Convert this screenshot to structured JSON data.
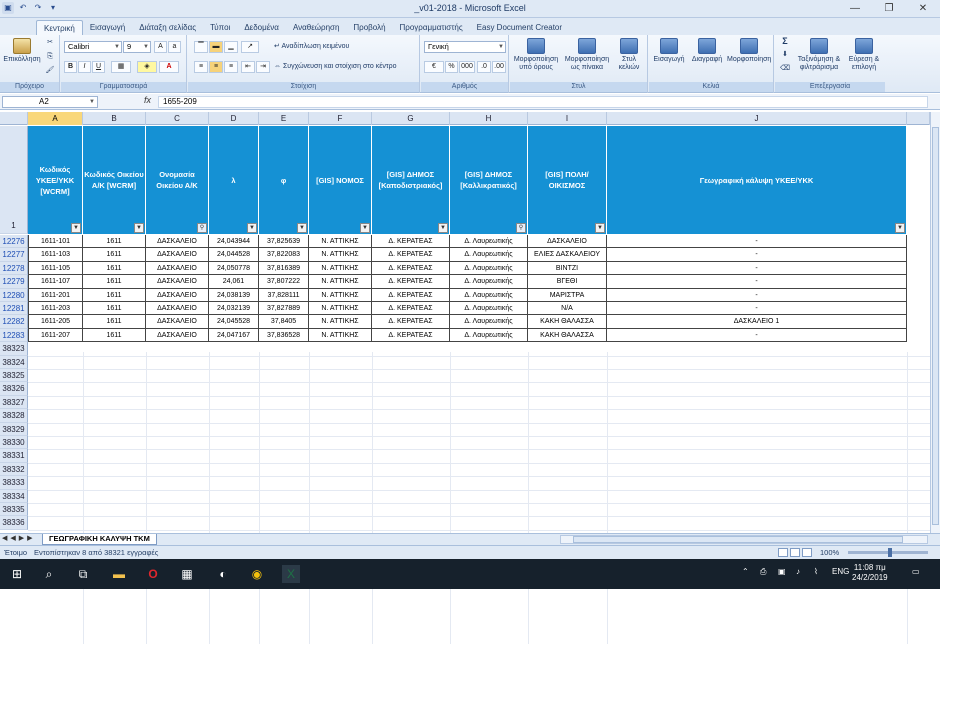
{
  "window": {
    "title": "_v01-2018 - Microsoft Excel",
    "minimize": "—",
    "maximize": "❐",
    "close": "✕"
  },
  "tabs": [
    "Κεντρική",
    "Εισαγωγή",
    "Διάταξη σελίδας",
    "Τύποι",
    "Δεδομένα",
    "Αναθεώρηση",
    "Προβολή",
    "Προγραμματιστής",
    "Easy Document Creator"
  ],
  "ribbon": {
    "clipboard": {
      "paste": "Επικόλληση",
      "label": "Πρόχειρο"
    },
    "font": {
      "name": "Calibri",
      "size": "9",
      "label": "Γραμματοσειρά",
      "bold": "B",
      "italic": "I",
      "underline": "U"
    },
    "alignment": {
      "wrap": "Αναδίπλωση κειμένου",
      "merge": "Συγχώνευση και στοίχιση στο κέντρο",
      "label": "Στοίχιση"
    },
    "number": {
      "format": "Γενική",
      "percent": "%",
      "thousands": "000",
      "label": "Αριθμός"
    },
    "styles": {
      "conditional": "Μορφοποίηση υπό όρους",
      "table": "Μορφοποίηση ως πίνακα",
      "cell": "Στυλ κελιών",
      "label": "Στυλ"
    },
    "cells": {
      "insert": "Εισαγωγή",
      "delete": "Διαγραφή",
      "format": "Μορφοποίηση",
      "label": "Κελιά"
    },
    "editing": {
      "sort": "Ταξινόμηση & φιλτράρισμα",
      "find": "Εύρεση & επιλογή",
      "label": "Επεξεργασία",
      "sum": "Σ"
    }
  },
  "formula_bar": {
    "name_box": "A2",
    "fx": "fx",
    "value": "1655-209"
  },
  "columns": [
    "A",
    "B",
    "C",
    "D",
    "E",
    "F",
    "G",
    "H",
    "I",
    "J"
  ],
  "header_row_number": "1",
  "headers": [
    "Κωδικός ΥΚΕΕ/ΥΚΚ [WCRM]",
    "Κωδικός Οικείου Α/Κ [WCRM]",
    "Ονομασία Οικείου Α/Κ",
    "λ",
    "φ",
    "[GIS] ΝΟΜΟΣ",
    "[GIS] ΔΗΜΟΣ [Καποδιστριακός]",
    "[GIS] ΔΗΜΟΣ [Καλλικρατικός]",
    "[GIS] ΠΟΛΗ/ΟΙΚΙΣΜΟΣ",
    "Γεωγραφική κάλυψη ΥΚΕΕ/ΥΚΚ"
  ],
  "rows": [
    {
      "n": "12276",
      "cells": [
        "1611-101",
        "1611",
        "ΔΑΣΚΑΛΕΙΟ",
        "24,043944",
        "37,825639",
        "Ν. ΑΤΤΙΚΗΣ",
        "Δ. ΚΕΡΑΤΕΑΣ",
        "Δ. Λαυρεωτικής",
        "ΔΑΣΚΑΛΕΙΟ",
        "-"
      ]
    },
    {
      "n": "12277",
      "cells": [
        "1611-103",
        "1611",
        "ΔΑΣΚΑΛΕΙΟ",
        "24,044528",
        "37,822083",
        "Ν. ΑΤΤΙΚΗΣ",
        "Δ. ΚΕΡΑΤΕΑΣ",
        "Δ. Λαυρεωτικής",
        "ΕΛΙΕΣ ΔΑΣΚΑΛΕΙΟΥ",
        "-"
      ]
    },
    {
      "n": "12278",
      "cells": [
        "1611-105",
        "1611",
        "ΔΑΣΚΑΛΕΙΟ",
        "24,050778",
        "37,816389",
        "Ν. ΑΤΤΙΚΗΣ",
        "Δ. ΚΕΡΑΤΕΑΣ",
        "Δ. Λαυρεωτικής",
        "ΒΙΝΤΖΙ",
        "-"
      ]
    },
    {
      "n": "12279",
      "cells": [
        "1611-107",
        "1611",
        "ΔΑΣΚΑΛΕΙΟ",
        "24,061",
        "37,807222",
        "Ν. ΑΤΤΙΚΗΣ",
        "Δ. ΚΕΡΑΤΕΑΣ",
        "Δ. Λαυρεωτικής",
        "ΒΓΕΘΙ",
        "-"
      ]
    },
    {
      "n": "12280",
      "cells": [
        "1611-201",
        "1611",
        "ΔΑΣΚΑΛΕΙΟ",
        "24,038139",
        "37,828111",
        "Ν. ΑΤΤΙΚΗΣ",
        "Δ. ΚΕΡΑΤΕΑΣ",
        "Δ. Λαυρεωτικής",
        "ΜΑΡΙΣΤΡΑ",
        "-"
      ]
    },
    {
      "n": "12281",
      "cells": [
        "1611-203",
        "1611",
        "ΔΑΣΚΑΛΕΙΟ",
        "24,032139",
        "37,827889",
        "Ν. ΑΤΤΙΚΗΣ",
        "Δ. ΚΕΡΑΤΕΑΣ",
        "Δ. Λαυρεωτικής",
        "N/A",
        "-"
      ]
    },
    {
      "n": "12282",
      "cells": [
        "1611-205",
        "1611",
        "ΔΑΣΚΑΛΕΙΟ",
        "24,045528",
        "37,8405",
        "Ν. ΑΤΤΙΚΗΣ",
        "Δ. ΚΕΡΑΤΕΑΣ",
        "Δ. Λαυρεωτικής",
        "ΚΑΚΗ ΘΑΛΑΣΣΑ",
        "ΔΑΣΚΑΛΕΙΟ 1"
      ]
    },
    {
      "n": "12283",
      "cells": [
        "1611-207",
        "1611",
        "ΔΑΣΚΑΛΕΙΟ",
        "24,047167",
        "37,836528",
        "Ν. ΑΤΤΙΚΗΣ",
        "Δ. ΚΕΡΑΤΕΑΣ",
        "Δ. Λαυρεωτικής",
        "ΚΑΚΗ ΘΑΛΑΣΣΑ",
        "-"
      ]
    }
  ],
  "empty_rows": [
    "38323",
    "38324",
    "38325",
    "38326",
    "38327",
    "38328",
    "38329",
    "38330",
    "38331",
    "38332",
    "38333",
    "38334",
    "38335",
    "38336"
  ],
  "sheet_tab": "ΓΕΩΓΡΑΦΙΚΗ ΚΑΛΥΨΗ ΤΚΜ",
  "status": {
    "ready": "Έτοιμο",
    "filter_msg": "Εντοπίστηκαν 8 από 38321 εγγραφές",
    "zoom": "100%"
  },
  "taskbar": {
    "lang": "ENG",
    "time": "11:08 πμ",
    "date": "24/2/2019"
  },
  "colors": {
    "header_bg": "#1591d4",
    "header_text": "#ffffff",
    "selected_col": "#f9d77a"
  }
}
